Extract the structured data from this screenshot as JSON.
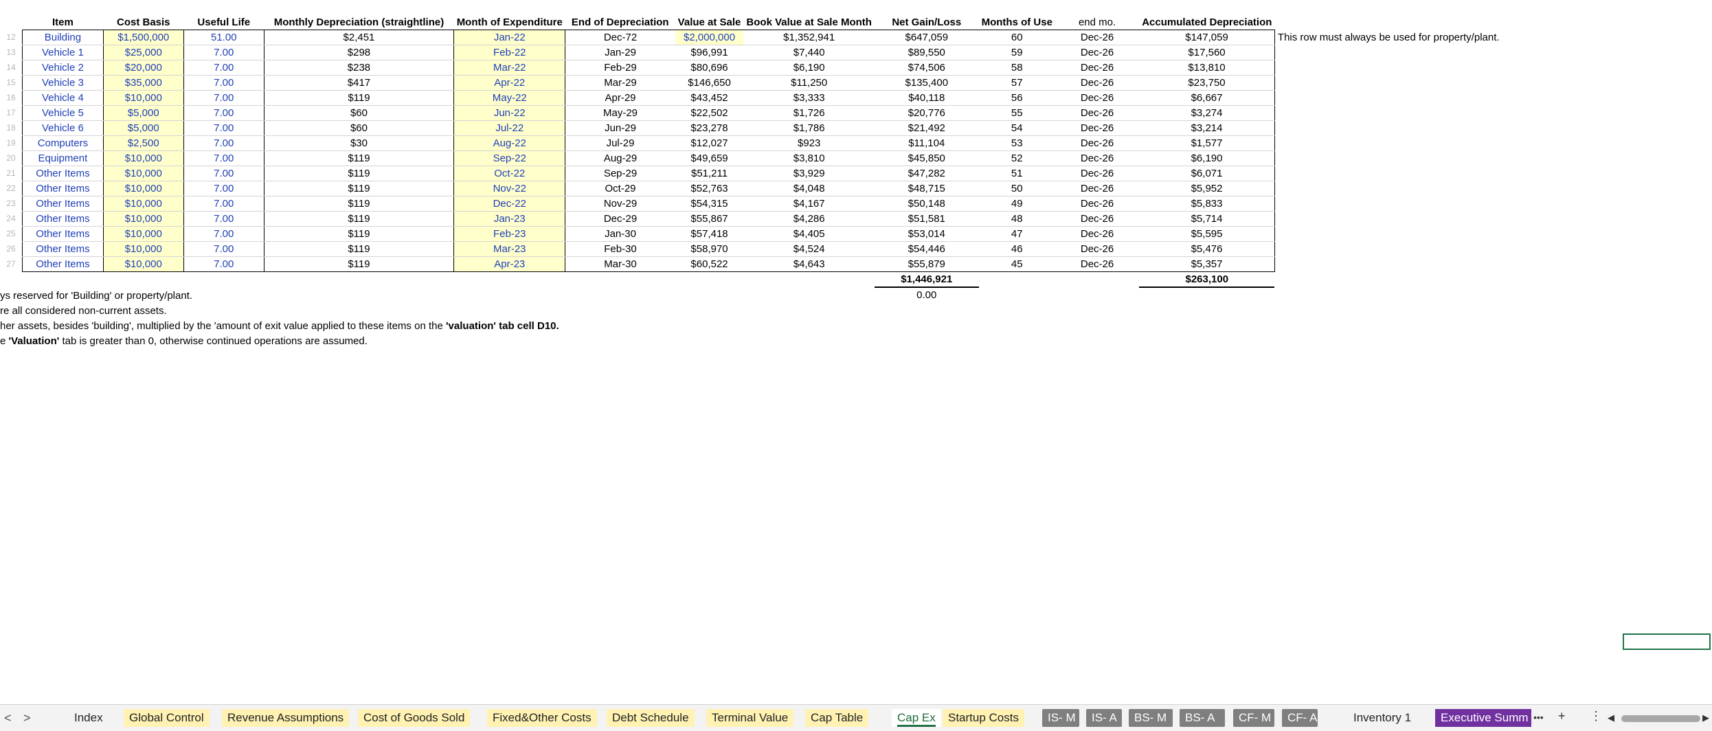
{
  "headers": [
    "Item",
    "Cost Basis",
    "Useful Life",
    "Monthly Depreciation (straightline)",
    "Month of Expenditure",
    "End of Depreciation",
    "Value at Sale",
    "Book Value at Sale Month",
    "Net Gain/Loss",
    "Months of Use",
    "end mo.",
    "Accumulated Depreciation"
  ],
  "rows": [
    {
      "rn": "12",
      "cells": [
        "Building",
        "$1,500,000",
        "51.00",
        "$2,451",
        "Jan-22",
        "Dec-72",
        "$2,000,000",
        "$1,352,941",
        "$647,059",
        "60",
        "Dec-26",
        "$147,059"
      ],
      "note": "This row must always be used for property/plant."
    },
    {
      "rn": "13",
      "cells": [
        "Vehicle 1",
        "$25,000",
        "7.00",
        "$298",
        "Feb-22",
        "Jan-29",
        "$96,991",
        "$7,440",
        "$89,550",
        "59",
        "Dec-26",
        "$17,560"
      ]
    },
    {
      "rn": "14",
      "cells": [
        "Vehicle 2",
        "$20,000",
        "7.00",
        "$238",
        "Mar-22",
        "Feb-29",
        "$80,696",
        "$6,190",
        "$74,506",
        "58",
        "Dec-26",
        "$13,810"
      ]
    },
    {
      "rn": "15",
      "cells": [
        "Vehicle 3",
        "$35,000",
        "7.00",
        "$417",
        "Apr-22",
        "Mar-29",
        "$146,650",
        "$11,250",
        "$135,400",
        "57",
        "Dec-26",
        "$23,750"
      ]
    },
    {
      "rn": "16",
      "cells": [
        "Vehicle 4",
        "$10,000",
        "7.00",
        "$119",
        "May-22",
        "Apr-29",
        "$43,452",
        "$3,333",
        "$40,118",
        "56",
        "Dec-26",
        "$6,667"
      ]
    },
    {
      "rn": "17",
      "cells": [
        "Vehicle 5",
        "$5,000",
        "7.00",
        "$60",
        "Jun-22",
        "May-29",
        "$22,502",
        "$1,726",
        "$20,776",
        "55",
        "Dec-26",
        "$3,274"
      ]
    },
    {
      "rn": "18",
      "cells": [
        "Vehicle 6",
        "$5,000",
        "7.00",
        "$60",
        "Jul-22",
        "Jun-29",
        "$23,278",
        "$1,786",
        "$21,492",
        "54",
        "Dec-26",
        "$3,214"
      ]
    },
    {
      "rn": "19",
      "cells": [
        "Computers",
        "$2,500",
        "7.00",
        "$30",
        "Aug-22",
        "Jul-29",
        "$12,027",
        "$923",
        "$11,104",
        "53",
        "Dec-26",
        "$1,577"
      ]
    },
    {
      "rn": "20",
      "cells": [
        "Equipment",
        "$10,000",
        "7.00",
        "$119",
        "Sep-22",
        "Aug-29",
        "$49,659",
        "$3,810",
        "$45,850",
        "52",
        "Dec-26",
        "$6,190"
      ]
    },
    {
      "rn": "21",
      "cells": [
        "Other Items",
        "$10,000",
        "7.00",
        "$119",
        "Oct-22",
        "Sep-29",
        "$51,211",
        "$3,929",
        "$47,282",
        "51",
        "Dec-26",
        "$6,071"
      ]
    },
    {
      "rn": "22",
      "cells": [
        "Other Items",
        "$10,000",
        "7.00",
        "$119",
        "Nov-22",
        "Oct-29",
        "$52,763",
        "$4,048",
        "$48,715",
        "50",
        "Dec-26",
        "$5,952"
      ]
    },
    {
      "rn": "23",
      "cells": [
        "Other Items",
        "$10,000",
        "7.00",
        "$119",
        "Dec-22",
        "Nov-29",
        "$54,315",
        "$4,167",
        "$50,148",
        "49",
        "Dec-26",
        "$5,833"
      ]
    },
    {
      "rn": "24",
      "cells": [
        "Other Items",
        "$10,000",
        "7.00",
        "$119",
        "Jan-23",
        "Dec-29",
        "$55,867",
        "$4,286",
        "$51,581",
        "48",
        "Dec-26",
        "$5,714"
      ]
    },
    {
      "rn": "25",
      "cells": [
        "Other Items",
        "$10,000",
        "7.00",
        "$119",
        "Feb-23",
        "Jan-30",
        "$57,418",
        "$4,405",
        "$53,014",
        "47",
        "Dec-26",
        "$5,595"
      ]
    },
    {
      "rn": "26",
      "cells": [
        "Other Items",
        "$10,000",
        "7.00",
        "$119",
        "Mar-23",
        "Feb-30",
        "$58,970",
        "$4,524",
        "$54,446",
        "46",
        "Dec-26",
        "$5,476"
      ]
    },
    {
      "rn": "27",
      "cells": [
        "Other Items",
        "$10,000",
        "7.00",
        "$119",
        "Apr-23",
        "Mar-30",
        "$60,522",
        "$4,643",
        "$55,879",
        "45",
        "Dec-26",
        "$5,357"
      ]
    }
  ],
  "totals": {
    "net_gain": "$1,446,921",
    "accum_dep": "$263,100",
    "check": "0.00"
  },
  "notes": [
    {
      "pre": "ys reserved for 'Building' or property/plant.",
      "bold": "",
      "post": ""
    },
    {
      "pre": "re all considered non-current assets.",
      "bold": "",
      "post": ""
    },
    {
      "pre": "her assets, besides 'building', multiplied by the 'amount of exit value applied to these items on the ",
      "bold": "'valuation' tab cell D10.",
      "post": ""
    },
    {
      "pre": "e ",
      "bold": "'Valuation'",
      "post": " tab is greater than 0, otherwise continued operations are assumed."
    }
  ],
  "tabs": [
    {
      "label": "Index",
      "style": "plain"
    },
    {
      "label": "Global Control",
      "style": "yellow"
    },
    {
      "label": "Revenue Assumptions",
      "style": "yellow"
    },
    {
      "label": "Cost of Goods Sold",
      "style": "yellow"
    },
    {
      "label": "Fixed&Other Costs",
      "style": "yellow"
    },
    {
      "label": "Debt Schedule",
      "style": "yellow"
    },
    {
      "label": "Terminal Value",
      "style": "yellow"
    },
    {
      "label": "Cap Table",
      "style": "yellow"
    },
    {
      "label": "Cap Ex",
      "style": "active"
    },
    {
      "label": "Startup Costs",
      "style": "yellow"
    },
    {
      "label": "IS- M",
      "style": "gray"
    },
    {
      "label": "IS- A",
      "style": "gray"
    },
    {
      "label": "BS- M",
      "style": "gray"
    },
    {
      "label": "BS- A",
      "style": "gray"
    },
    {
      "label": "CF- M",
      "style": "gray"
    },
    {
      "label": "CF- A",
      "style": "gray"
    },
    {
      "label": "Inventory 1",
      "style": "plain"
    },
    {
      "label": "Executive Summ",
      "style": "purple"
    }
  ],
  "tab_controls": {
    "prev": "<",
    "next": ">",
    "more": "•••",
    "add": "+",
    "menu": "⋮"
  },
  "colors": {
    "input_blue": "#1f3fb6",
    "input_fill": "#ffffcc",
    "selection": "#217346",
    "purple_tab": "#7030a0",
    "gray_tab": "#7f7f7f"
  }
}
